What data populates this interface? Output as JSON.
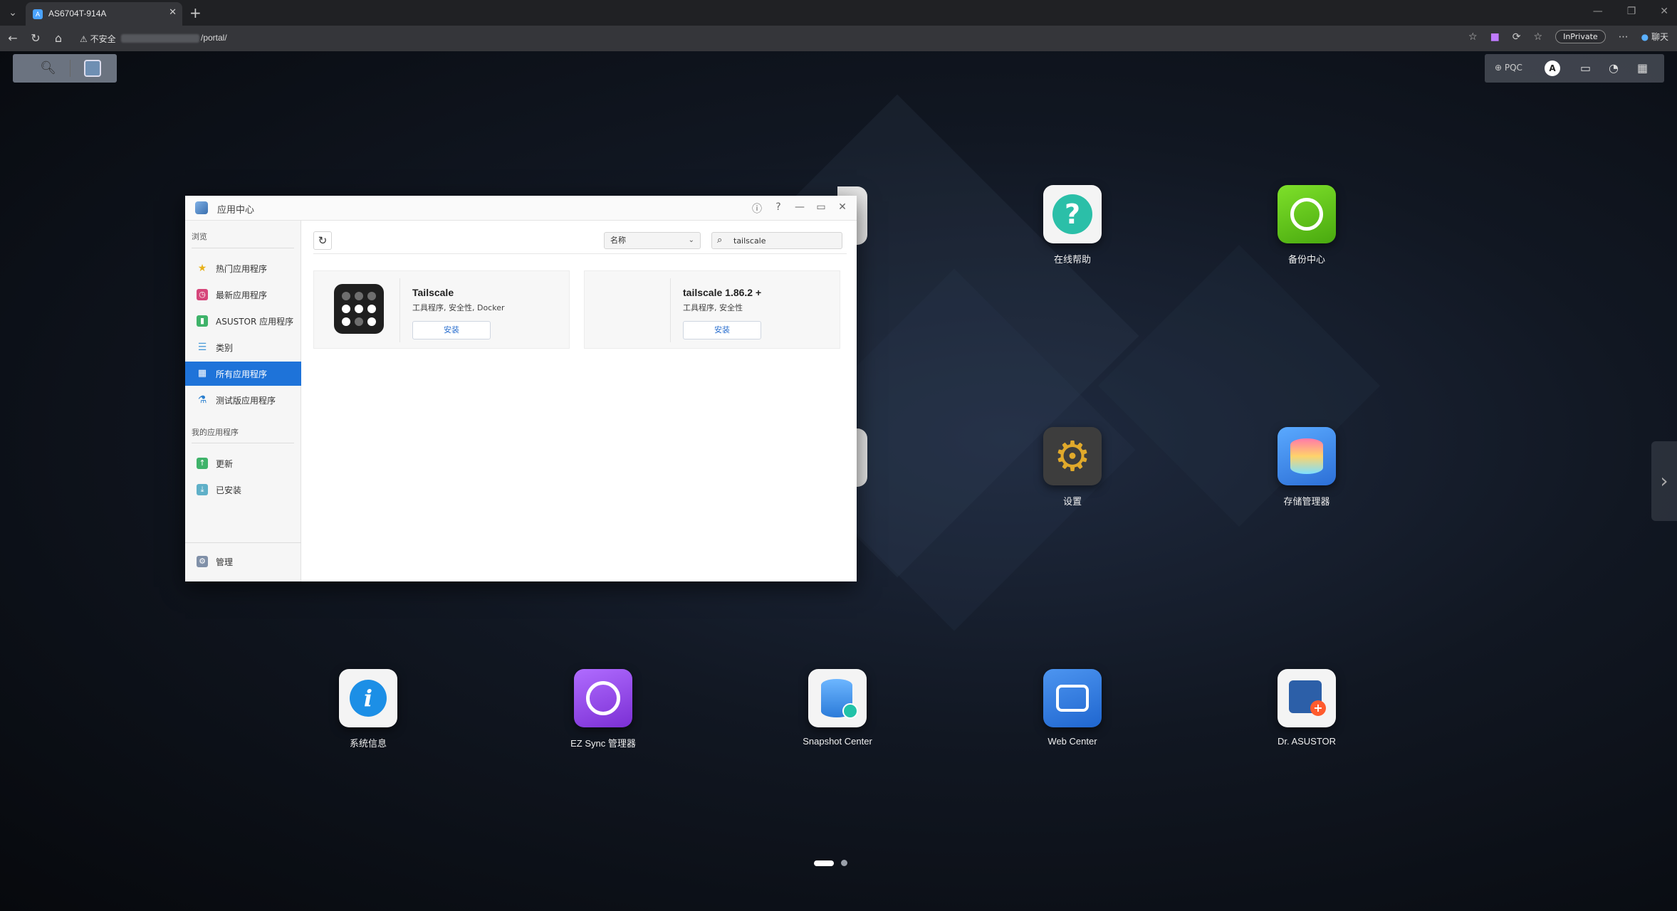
{
  "browser": {
    "tab_title": "AS6704T-914A",
    "insecure_label": "不安全",
    "url_suffix": "/portal/",
    "inprivate_label": "InPrivate",
    "chat_label": "聊天"
  },
  "topbar": {
    "pqc_label": "PQC",
    "avatar_letter": "A"
  },
  "desktop_icons": [
    {
      "label": "在线帮助",
      "color": "#2bbfa8"
    },
    {
      "label": "备份中心",
      "color": "#6ac61b"
    },
    {
      "label": "设置",
      "color": "#3a3a3a"
    },
    {
      "label": "存储管理器",
      "color": "#3c8ee6"
    },
    {
      "label": "系统信息",
      "color": "#f2f2f2"
    },
    {
      "label": "EZ Sync 管理器",
      "color": "#9b53e6"
    },
    {
      "label": "Snapshot Center",
      "color": "#f2f2f2"
    },
    {
      "label": "Web Center",
      "color": "#2f7be0"
    },
    {
      "label": "Dr. ASUSTOR",
      "color": "#f2f2f2"
    }
  ],
  "app_window": {
    "title": "应用中心",
    "sidebar": {
      "browse_title": "浏览",
      "items": [
        {
          "label": "热门应用程序"
        },
        {
          "label": "最新应用程序"
        },
        {
          "label": "ASUSTOR 应用程序"
        },
        {
          "label": "类别"
        },
        {
          "label": "所有应用程序"
        },
        {
          "label": "测试版应用程序"
        }
      ],
      "my_apps_title": "我的应用程序",
      "my_items": [
        {
          "label": "更新"
        },
        {
          "label": "已安装"
        }
      ],
      "manage_label": "管理"
    },
    "toolbar": {
      "sort_value": "名称",
      "search_value": "tailscale"
    },
    "results": [
      {
        "name": "Tailscale",
        "tags": "工具程序, 安全性, Docker",
        "button": "安装"
      },
      {
        "name": "tailscale 1.86.2 +",
        "tags": "工具程序, 安全性",
        "button": "安装"
      }
    ]
  },
  "accent_color": "#1e73d9"
}
